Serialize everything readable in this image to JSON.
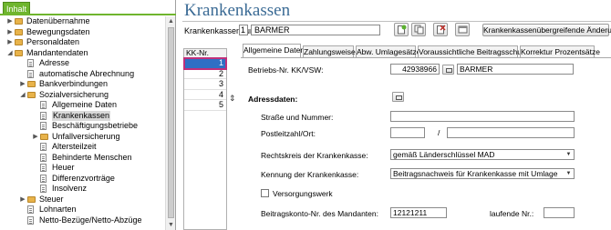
{
  "left_tab": "Inhalt",
  "tree": [
    {
      "label": "Datenübernahme",
      "level": 0,
      "icon": "folder-icon",
      "arrow": "▶"
    },
    {
      "label": "Bewegungsdaten",
      "level": 0,
      "icon": "folder-icon",
      "arrow": "▶"
    },
    {
      "label": "Personaldaten",
      "level": 0,
      "icon": "folder-icon",
      "arrow": "▶"
    },
    {
      "label": "Mandantendaten",
      "level": 0,
      "icon": "folder-icon",
      "arrow": "◢"
    },
    {
      "label": "Adresse",
      "level": 1,
      "icon": "document-icon",
      "arrow": ""
    },
    {
      "label": "automatische Abrechnung",
      "level": 1,
      "icon": "document-icon",
      "arrow": ""
    },
    {
      "label": "Bankverbindungen",
      "level": 1,
      "icon": "folder-icon",
      "arrow": "▶"
    },
    {
      "label": "Sozialversicherung",
      "level": 1,
      "icon": "folder-icon",
      "arrow": "◢"
    },
    {
      "label": "Allgemeine Daten",
      "level": 2,
      "icon": "document-icon",
      "arrow": ""
    },
    {
      "label": "Krankenkassen",
      "level": 2,
      "icon": "document-icon",
      "arrow": "",
      "selected": true
    },
    {
      "label": "Beschäftigungsbetriebe",
      "level": 2,
      "icon": "document-icon",
      "arrow": ""
    },
    {
      "label": "Unfallversicherung",
      "level": 2,
      "icon": "folder-icon",
      "arrow": "▶"
    },
    {
      "label": "Altersteilzeit",
      "level": 2,
      "icon": "document-icon",
      "arrow": ""
    },
    {
      "label": "Behinderte Menschen",
      "level": 2,
      "icon": "document-icon",
      "arrow": ""
    },
    {
      "label": "Heuer",
      "level": 2,
      "icon": "document-icon",
      "arrow": ""
    },
    {
      "label": "Differenzvorträge",
      "level": 2,
      "icon": "document-icon",
      "arrow": ""
    },
    {
      "label": "Insolvenz",
      "level": 2,
      "icon": "document-icon",
      "arrow": ""
    },
    {
      "label": "Steuer",
      "level": 1,
      "icon": "folder-icon",
      "arrow": "▶"
    },
    {
      "label": "Lohnarten",
      "level": 1,
      "icon": "document-icon",
      "arrow": ""
    },
    {
      "label": "Netto-Bezüge/Netto-Abzüge",
      "level": 1,
      "icon": "document-icon",
      "arrow": ""
    }
  ],
  "page_title": "Krankenkassen",
  "header": {
    "kassennr_label": "Krankenkassennummer:",
    "kassennr_value": "1",
    "kassenname_value": "BARMER",
    "wide_button": "Krankenkassenübergreifende Änderungen"
  },
  "kk_list": {
    "header": "KK-Nr.",
    "rows": [
      "1",
      "2",
      "3",
      "4",
      "5"
    ]
  },
  "tabs": [
    {
      "label": "Allgemeine Daten",
      "active": true
    },
    {
      "label": "Zahlungsweise",
      "active": false
    },
    {
      "label": "Abw. Umlagesätze",
      "active": false
    },
    {
      "label": "Voraussichtliche Beitragsschuld",
      "active": false
    },
    {
      "label": "Korrektur Prozentsätze",
      "active": false
    }
  ],
  "form": {
    "betriebsnr_label": "Betriebs-Nr. KK/VSW:",
    "betriebsnr_value": "42938966",
    "betriebsnr_name": "BARMER",
    "adressdaten_label": "Adressdaten:",
    "strasse_label": "Straße und Nummer:",
    "strasse_value": "",
    "plz_label": "Postleitzahl/Ort:",
    "plz_value": "",
    "plz_sep": "/",
    "ort_value": "",
    "rechtskreis_label": "Rechtskreis der Krankenkasse:",
    "rechtskreis_value": "gemäß Länderschlüssel MAD",
    "kennung_label": "Kennung der Krankenkasse:",
    "kennung_value": "Beitragsnachweis für Krankenkasse mit Umlage",
    "versorgungswerk_label": "Versorgungswerk",
    "beitragskonto_label": "Beitragskonto-Nr. des Mandanten:",
    "beitragskonto_value": "12121211",
    "laufende_label": "laufende Nr.:",
    "laufende_value": ""
  }
}
